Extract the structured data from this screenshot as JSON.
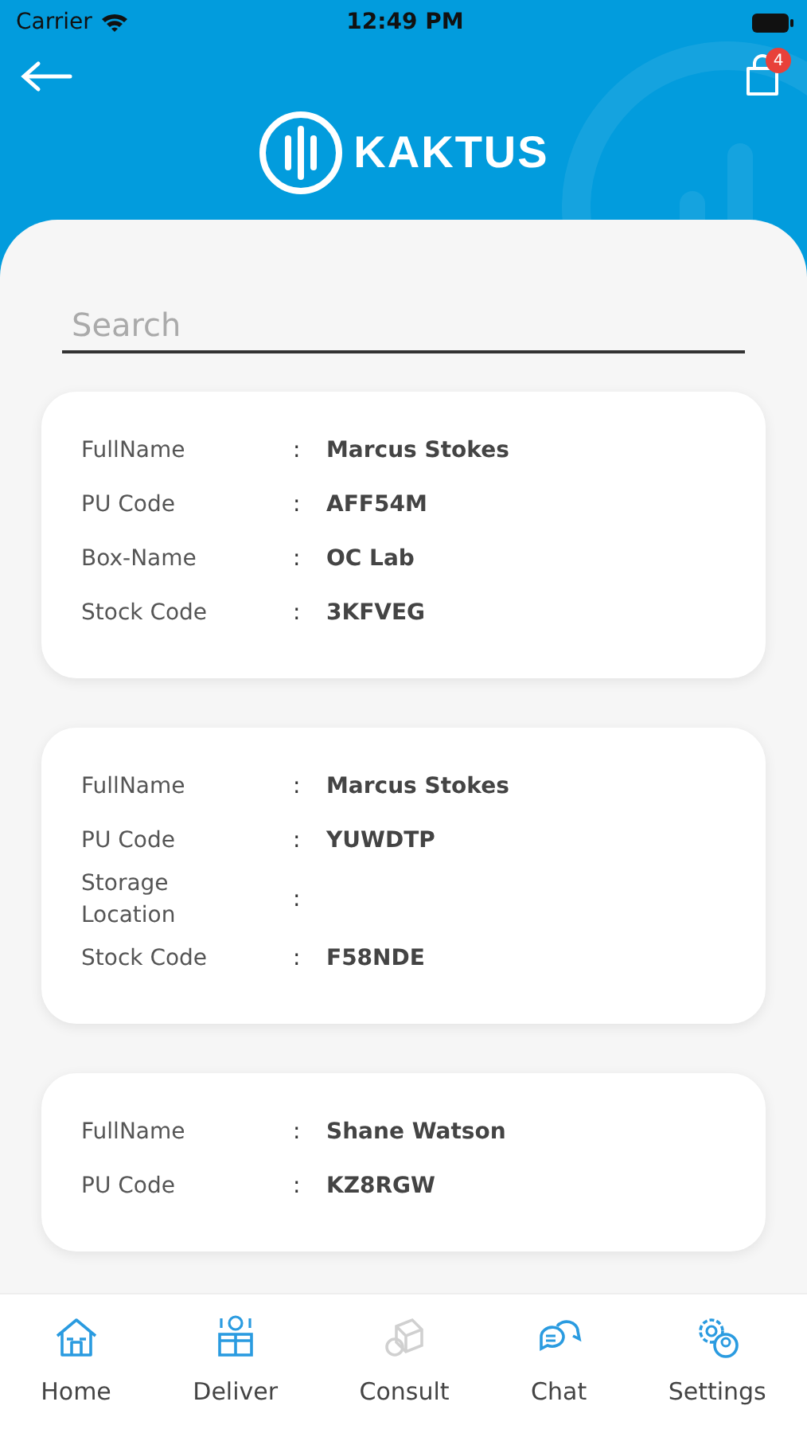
{
  "status_bar": {
    "carrier": "Carrier",
    "time": "12:49 PM"
  },
  "header": {
    "logo_text": "KAKTUS",
    "cart_badge": "4"
  },
  "search": {
    "placeholder": "Search"
  },
  "cards": [
    {
      "rows": [
        {
          "label": "FullName",
          "separator": ":",
          "value": "Marcus Stokes"
        },
        {
          "label": "PU Code",
          "separator": ":",
          "value": "AFF54M"
        },
        {
          "label": "Box-Name",
          "separator": ":",
          "value": "OC Lab"
        },
        {
          "label": "Stock Code",
          "separator": ":",
          "value": "3KFVEG"
        }
      ]
    },
    {
      "rows": [
        {
          "label": "FullName",
          "separator": ":",
          "value": "Marcus Stokes"
        },
        {
          "label": "PU Code",
          "separator": ":",
          "value": "YUWDTP"
        },
        {
          "label": "Storage Location",
          "separator": ":"
        },
        {
          "label": "Stock Code",
          "separator": ":",
          "value": "F58NDE"
        }
      ]
    },
    {
      "rows": [
        {
          "label": "FullName",
          "separator": ":",
          "value": "Shane Watson"
        },
        {
          "label": "PU Code",
          "separator": ":",
          "value": "KZ8RGW"
        }
      ]
    }
  ],
  "tabs": [
    {
      "kind": "home",
      "label": "Home",
      "disabled": false
    },
    {
      "kind": "deliver",
      "label": "Deliver",
      "disabled": false
    },
    {
      "kind": "consult",
      "label": "Consult",
      "disabled": true
    },
    {
      "kind": "chat",
      "label": "Chat",
      "disabled": false
    },
    {
      "kind": "settings",
      "label": "Settings",
      "disabled": false
    }
  ]
}
